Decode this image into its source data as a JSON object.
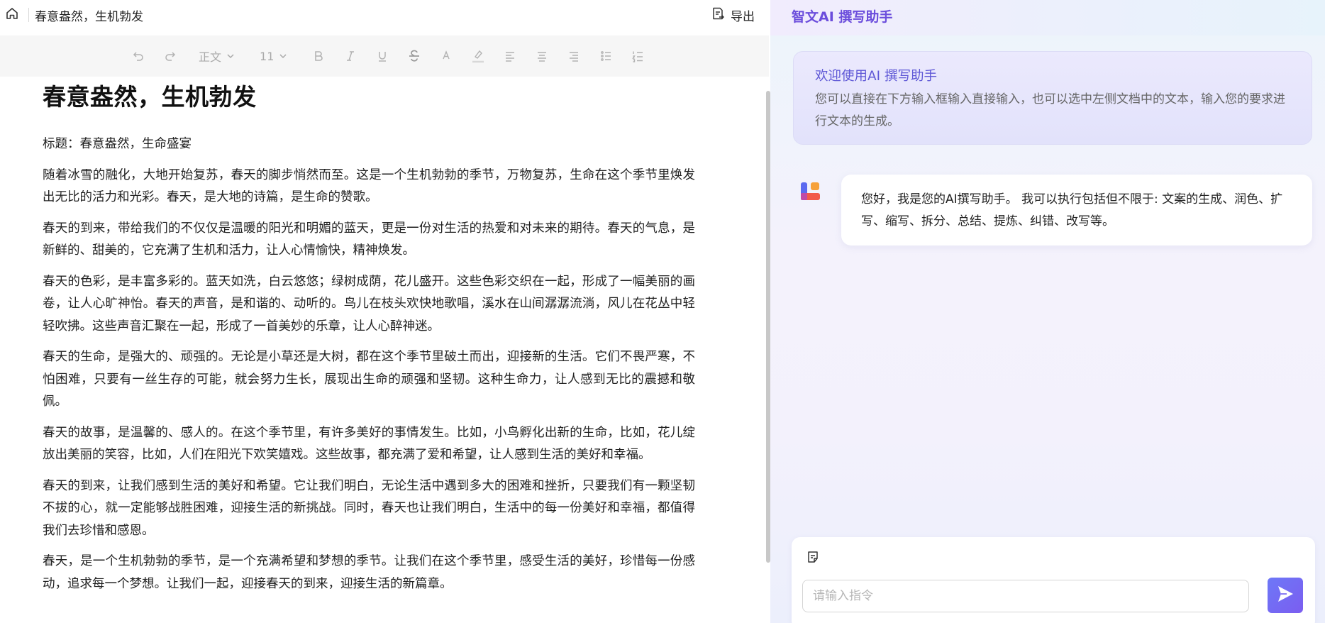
{
  "editor": {
    "tab_title": "春意盎然，生机勃发",
    "export_label": "导出",
    "toolbar": {
      "style_label": "正文",
      "size_label": "11"
    },
    "doc_heading": "春意盎然，生机勃发",
    "paragraphs": [
      "标题：春意盎然，生命盛宴",
      "随着冰雪的融化，大地开始复苏，春天的脚步悄然而至。这是一个生机勃勃的季节，万物复苏，生命在这个季节里焕发出无比的活力和光彩。春天，是大地的诗篇，是生命的赞歌。",
      "春天的到来，带给我们的不仅仅是温暖的阳光和明媚的蓝天，更是一份对生活的热爱和对未来的期待。春天的气息，是新鲜的、甜美的，它充满了生机和活力，让人心情愉快，精神焕发。",
      "春天的色彩，是丰富多彩的。蓝天如洗，白云悠悠；绿树成荫，花儿盛开。这些色彩交织在一起，形成了一幅美丽的画卷，让人心旷神怡。春天的声音，是和谐的、动听的。鸟儿在枝头欢快地歌唱，溪水在山间潺潺流淌，风儿在花丛中轻轻吹拂。这些声音汇聚在一起，形成了一首美妙的乐章，让人心醉神迷。",
      "春天的生命，是强大的、顽强的。无论是小草还是大树，都在这个季节里破土而出，迎接新的生活。它们不畏严寒，不怕困难，只要有一丝生存的可能，就会努力生长，展现出生命的顽强和坚韧。这种生命力，让人感到无比的震撼和敬佩。",
      "春天的故事，是温馨的、感人的。在这个季节里，有许多美好的事情发生。比如，小鸟孵化出新的生命，比如，花儿绽放出美丽的笑容，比如，人们在阳光下欢笑嬉戏。这些故事，都充满了爱和希望，让人感到生活的美好和幸福。",
      "春天的到来，让我们感到生活的美好和希望。它让我们明白，无论生活中遇到多大的困难和挫折，只要我们有一颗坚韧不拔的心，就一定能够战胜困难，迎接生活的新挑战。同时，春天也让我们明白，生活中的每一份美好和幸福，都值得我们去珍惜和感恩。",
      "春天，是一个生机勃勃的季节，是一个充满希望和梦想的季节。让我们在这个季节里，感受生活的美好，珍惜每一份感动，追求每一个梦想。让我们一起，迎接春天的到来，迎接生活的新篇章。"
    ]
  },
  "assistant": {
    "app_title": "智文AI 撰写助手",
    "welcome_title": "欢迎使用AI 撰写助手",
    "welcome_desc": "您可以直接在下方输入框输入直接输入，也可以选中左侧文档中的文本，输入您的要求进行文本的生成。",
    "bot_message": "您好，我是您的AI撰写助手。 我可以执行包括但不限于: 文案的生成、润色、扩写、缩写、拆分、总结、提炼、纠错、改写等。",
    "input_placeholder": "请输入指令"
  },
  "colors": {
    "accent": "#6b4ddc",
    "send_button": "#7b5df0",
    "toolbar_bg": "#f6f6f6"
  }
}
